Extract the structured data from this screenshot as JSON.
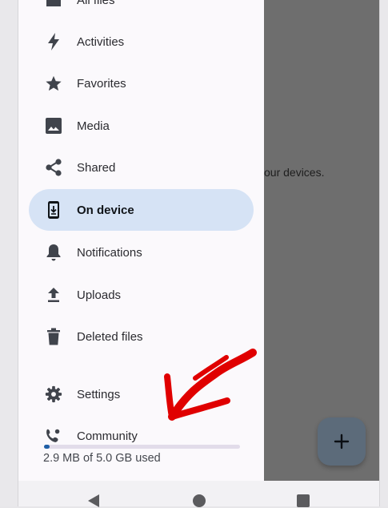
{
  "background": {
    "text": "our devices."
  },
  "drawer": {
    "items": [
      {
        "label": "All files",
        "icon": "folder-icon"
      },
      {
        "label": "Activities",
        "icon": "lightning-icon"
      },
      {
        "label": "Favorites",
        "icon": "star-icon"
      },
      {
        "label": "Media",
        "icon": "image-icon"
      },
      {
        "label": "Shared",
        "icon": "share-icon"
      },
      {
        "label": "On device",
        "icon": "phone-download-icon",
        "active": true
      },
      {
        "label": "Notifications",
        "icon": "bell-icon"
      },
      {
        "label": "Uploads",
        "icon": "upload-icon"
      },
      {
        "label": "Deleted files",
        "icon": "trash-icon"
      },
      {
        "label": "Settings",
        "icon": "gear-icon"
      },
      {
        "label": "Community",
        "icon": "community-icon"
      }
    ],
    "quota": {
      "text": "2.9 MB of 5.0 GB used",
      "used_fraction": 0.00058
    }
  },
  "fab": {
    "icon": "plus-icon"
  },
  "navbar": {
    "icons": [
      "back-icon",
      "home-icon",
      "recents-icon"
    ]
  },
  "colors": {
    "accent": "#1f5fa6",
    "active_item_bg": "#d6e3f5",
    "scrim": "#6e6e6e",
    "annotation": "#e00000"
  }
}
